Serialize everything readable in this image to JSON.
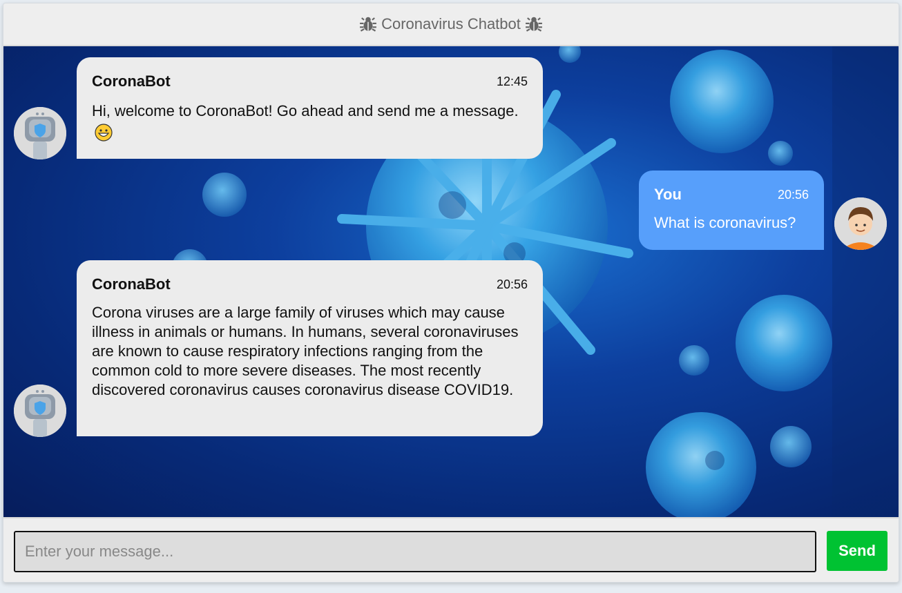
{
  "header": {
    "title": "Coronavirus Chatbot",
    "left_icon": "bug-icon",
    "right_icon": "bug-icon"
  },
  "messages": [
    {
      "sender": "CoronaBot",
      "side": "left",
      "time": "12:45",
      "text": "Hi, welcome to CoronaBot! Go ahead and send me a message.",
      "emoji": "grinning-face-emoji",
      "avatar": "robot-avatar"
    },
    {
      "sender": "You",
      "side": "right",
      "time": "20:56",
      "text": "What is coronavirus?",
      "avatar": "user-avatar"
    },
    {
      "sender": "CoronaBot",
      "side": "left",
      "time": "20:56",
      "text": "Corona viruses are a large family of viruses which may cause illness in animals or humans. In humans, several coronaviruses are known to cause respiratory infections ranging from the common cold to more severe diseases. The most recently discovered coronavirus causes coronavirus disease COVID19.",
      "avatar": "robot-avatar"
    }
  ],
  "input": {
    "placeholder": "Enter your message...",
    "value": ""
  },
  "send_button": {
    "label": "Send"
  },
  "colors": {
    "bot_bubble": "#ececec",
    "user_bubble": "#579ffb",
    "send_button": "#00c232",
    "header_bg": "#eeeeee"
  }
}
